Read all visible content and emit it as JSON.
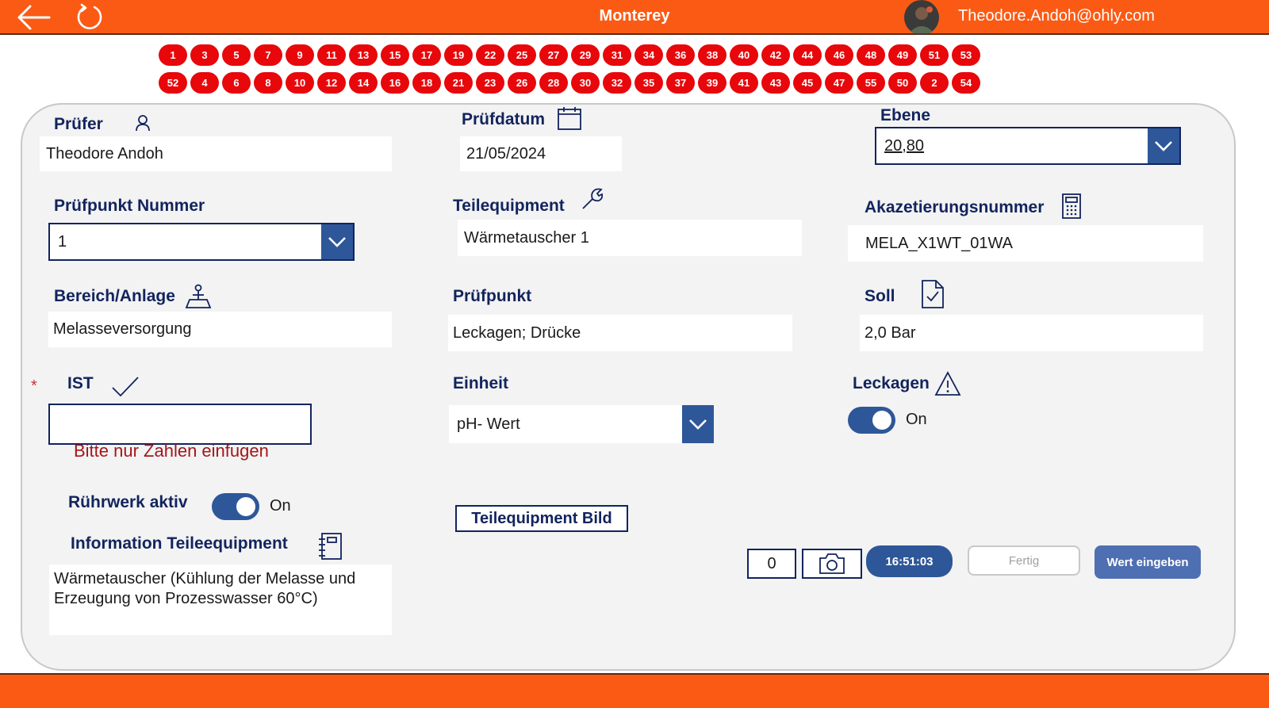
{
  "header": {
    "title": "Monterey",
    "user_email": "Theodore.Andoh@ohly.com"
  },
  "badges": {
    "row1": [
      "1",
      "3",
      "5",
      "7",
      "9",
      "11",
      "13",
      "15",
      "17",
      "19",
      "22",
      "25",
      "27",
      "29",
      "31",
      "34",
      "36",
      "38",
      "40",
      "42",
      "44",
      "46",
      "48",
      "49",
      "51",
      "53"
    ],
    "row2": [
      "52",
      "4",
      "6",
      "8",
      "10",
      "12",
      "14",
      "16",
      "18",
      "21",
      "23",
      "26",
      "28",
      "30",
      "32",
      "35",
      "37",
      "39",
      "41",
      "43",
      "45",
      "47",
      "55",
      "50",
      "2",
      "54"
    ]
  },
  "form": {
    "pruefer": {
      "label": "Prüfer",
      "value": "Theodore Andoh"
    },
    "pruefdatum": {
      "label": "Prüfdatum",
      "value": "21/05/2024"
    },
    "ebene": {
      "label": "Ebene",
      "value": "20,80"
    },
    "pruefpunkt_nummer": {
      "label": "Prüfpunkt Nummer",
      "value": "1"
    },
    "teilequipment": {
      "label": "Teilequipment",
      "value": "Wärmetauscher 1"
    },
    "akazetierungsnummer": {
      "label": "Akazetierungsnummer",
      "value": "MELA_X1WT_01WA"
    },
    "bereich": {
      "label": "Bereich/Anlage",
      "value": "Melasseversorgung"
    },
    "pruefpunkt": {
      "label": "Prüfpunkt",
      "value": "Leckagen; Drücke"
    },
    "soll": {
      "label": "Soll",
      "value": "2,0 Bar"
    },
    "ist": {
      "label": "IST",
      "required_mark": "*",
      "value": "",
      "error": "Bitte nur Zahlen einfugen"
    },
    "einheit": {
      "label": "Einheit",
      "value": "pH- Wert"
    },
    "leckagen": {
      "label": "Leckagen",
      "toggle_text": "On"
    },
    "ruehrwerk": {
      "label": "Rührwerk aktiv",
      "toggle_text": "On"
    },
    "information": {
      "label": "Information Teileequipment",
      "value": "Wärmetauscher (Kühlung der Melasse und Erzeugung von Prozesswasser 60°C)"
    }
  },
  "actions": {
    "teilequipment_bild": "Teilequipment Bild",
    "photo_count": "0",
    "time": "16:51:03",
    "fertig": "Fertig",
    "wert_eingeben": "Wert eingeben"
  },
  "colors": {
    "header": "#fb5a14",
    "badge": "#e8070b",
    "navy": "#12245e",
    "accent_blue": "#2e5799",
    "error": "#a4161a"
  }
}
